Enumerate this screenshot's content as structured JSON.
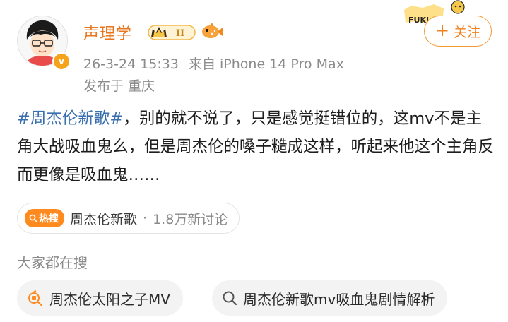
{
  "user": {
    "name": "声理学",
    "level_badge": "II",
    "verified_mark": "v"
  },
  "post_meta": {
    "time": "26-3-24 15:33",
    "source": "来自 iPhone 14 Pro Max",
    "location": "发布于 重庆"
  },
  "follow_button": {
    "label": "关注",
    "plus": "+"
  },
  "decoration": {
    "fuki_text": "FUKI"
  },
  "post": {
    "hashtag": "#周杰伦新歌#",
    "body": "，别的就不说了，只是感觉挺错位的，这mv不是主角大战吸血鬼么，但是周杰伦的嗓子糙成这样，听起来他这个主角反而更像是吸血鬼……"
  },
  "hot_topic": {
    "tag": "热搜",
    "title": "周杰伦新歌",
    "separator": "·",
    "count": "1.8万新讨论"
  },
  "related_search": {
    "label": "大家都在搜",
    "items": [
      {
        "text": "周杰伦太阳之子MV",
        "icon": "hot-search-icon"
      },
      {
        "text": "周杰伦新歌mv吸血鬼剧情解析",
        "icon": "search-icon"
      }
    ]
  },
  "colors": {
    "accent_orange": "#f08220",
    "username_orange": "#e8771f",
    "hashtag_blue": "#3a6fb0",
    "meta_gray": "#8a8a8a"
  }
}
